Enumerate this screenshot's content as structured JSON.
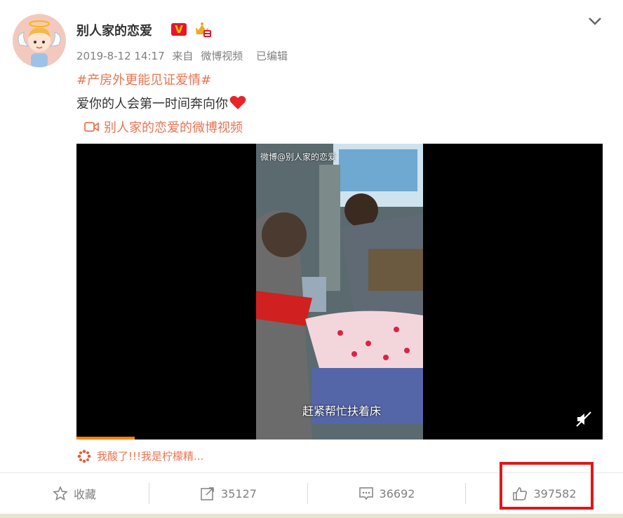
{
  "post": {
    "username": "别人家的恋爱",
    "verified_badge": "V",
    "vip_icon": "vip-crown-icon",
    "meta": {
      "time": "2019-8-12 14:17",
      "source_prefix": "来自",
      "source": "微博视频",
      "edited": "已编辑"
    },
    "hashtag": "#产房外更能见证爱情#",
    "text": "爱你的人会第一时间奔向你",
    "video_link": "别人家的恋爱的微博视频",
    "video": {
      "watermark": "微博@别人家的恋爱",
      "subtitle": "赶紧帮忙扶着床",
      "muted": true,
      "progress_percent": 11
    },
    "lemon_text": "我酸了!!!我是柠檬精..."
  },
  "actions": {
    "favorite": "收藏",
    "repost_count": "35127",
    "comment_count": "36692",
    "like_count": "397582"
  },
  "colors": {
    "accent": "#eb7350",
    "verified": "#e6162d",
    "highlight_box": "#e01818"
  }
}
